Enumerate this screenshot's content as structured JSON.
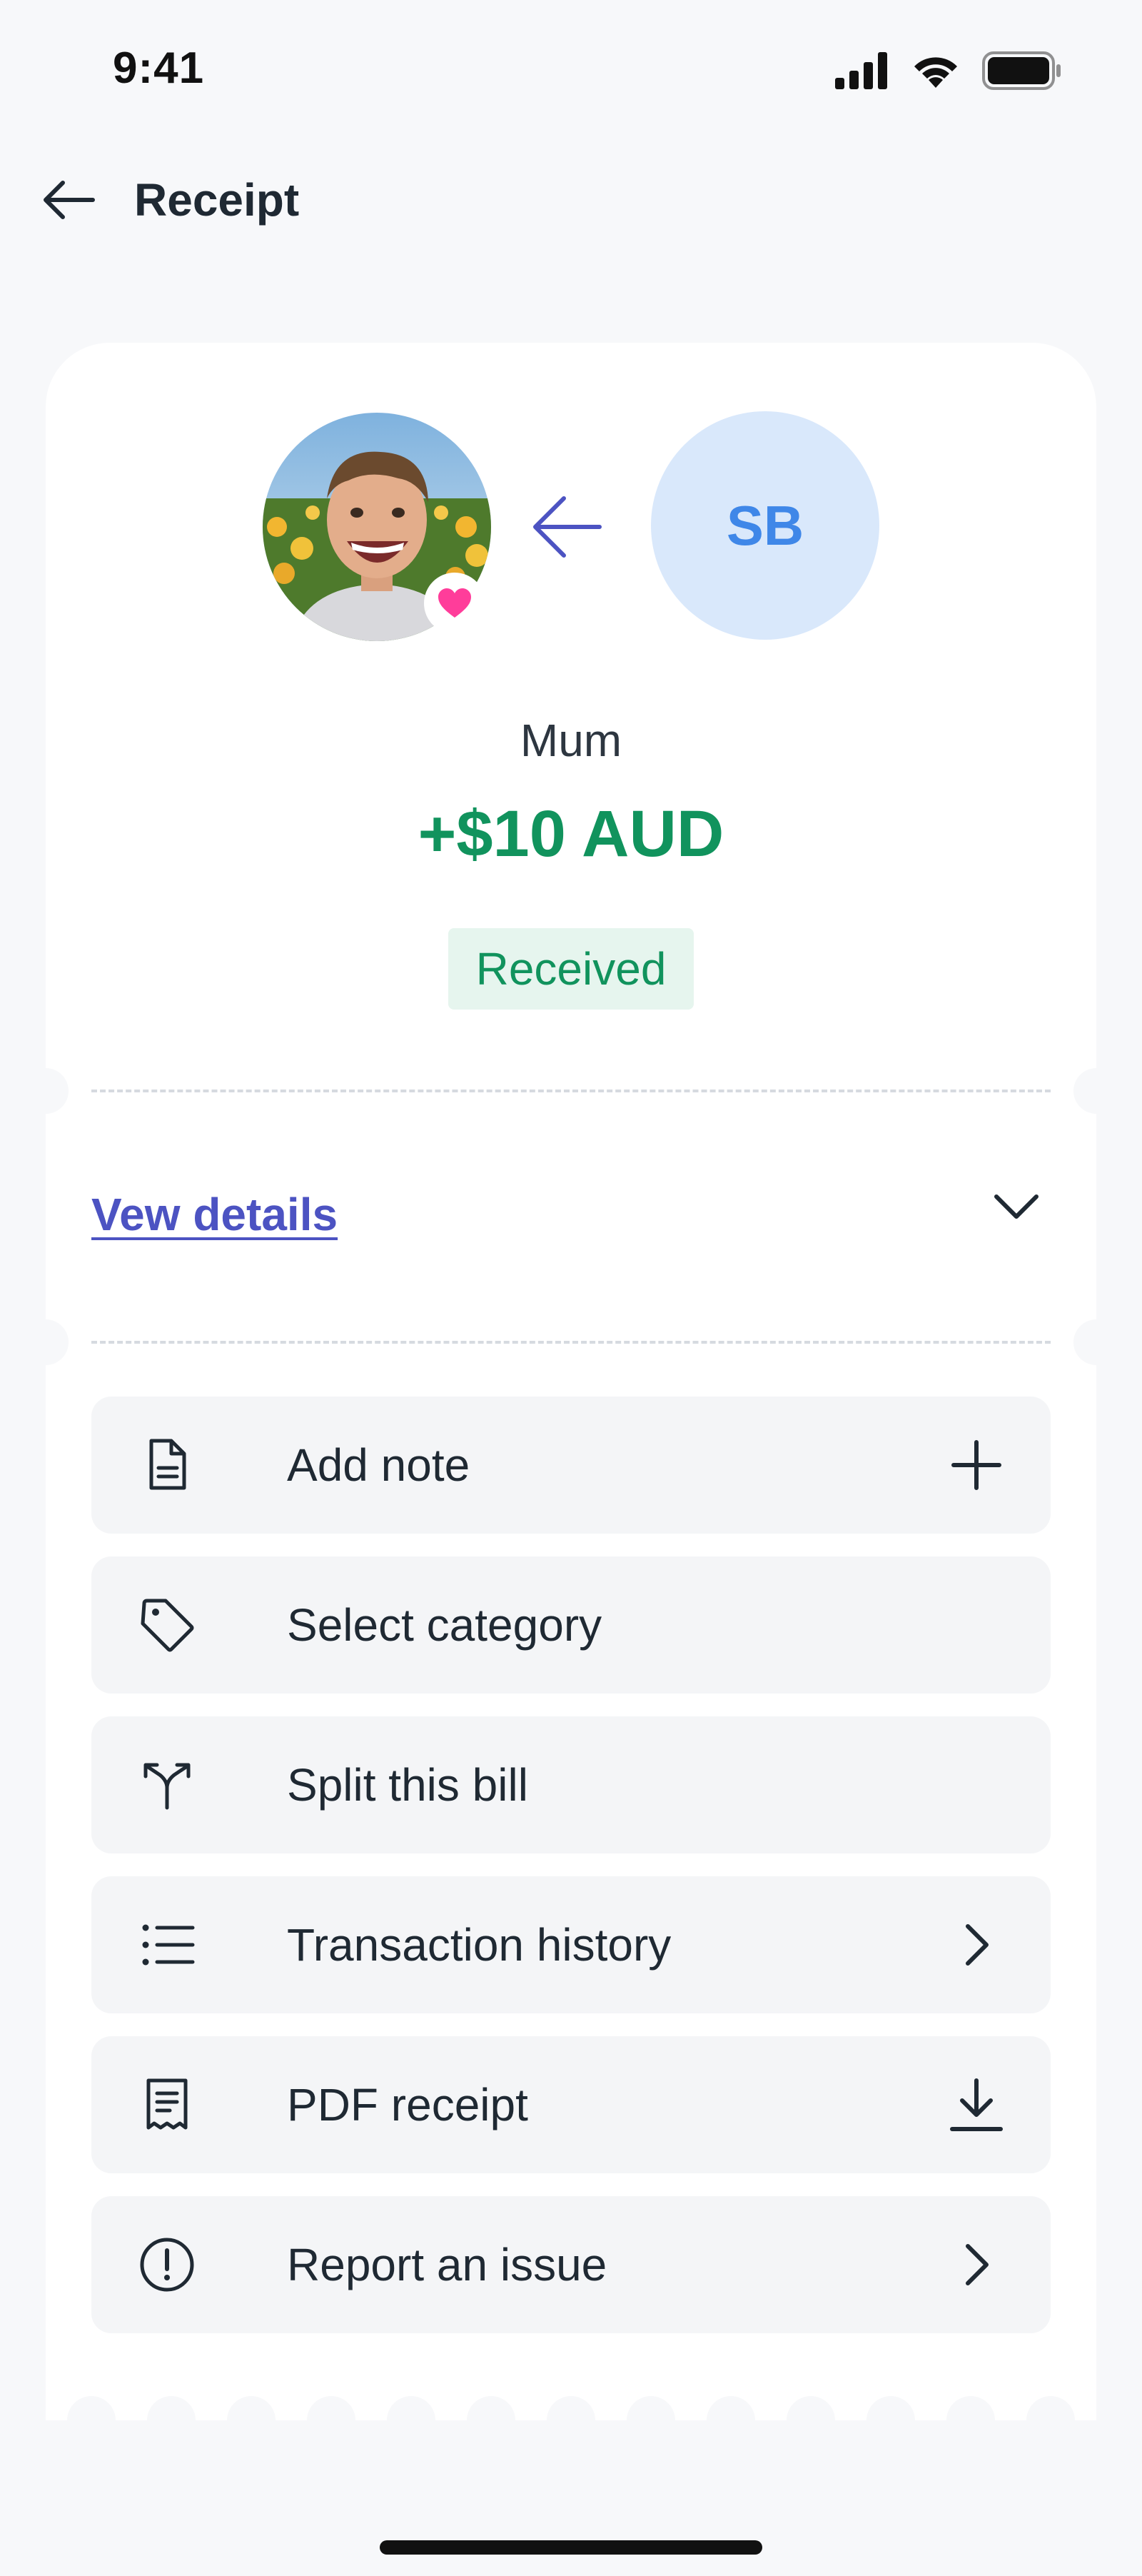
{
  "status_bar": {
    "time": "9:41"
  },
  "header": {
    "title": "Receipt"
  },
  "transfer": {
    "initials": "SB",
    "sender_name": "Mum",
    "amount": "+$10 AUD",
    "status": "Received"
  },
  "details": {
    "link_label": "Vew details"
  },
  "actions": [
    {
      "label": "Add note",
      "icon": "note-icon",
      "trailing": "plus-icon"
    },
    {
      "label": "Select category",
      "icon": "tag-icon",
      "trailing": ""
    },
    {
      "label": "Split this bill",
      "icon": "split-icon",
      "trailing": ""
    },
    {
      "label": "Transaction history",
      "icon": "list-icon",
      "trailing": "chevron-right-icon"
    },
    {
      "label": "PDF receipt",
      "icon": "receipt-icon",
      "trailing": "download-icon"
    },
    {
      "label": "Report an issue",
      "icon": "alert-circle-icon",
      "trailing": "chevron-right-icon"
    }
  ],
  "colors": {
    "accent": "#4c53c2",
    "positive": "#11935d",
    "positive_bg": "#e6f5ee",
    "avatar_bg": "#d9e8fb",
    "avatar_text": "#3f87e8",
    "heart": "#ff3d9a",
    "background": "#f7f8fa"
  }
}
